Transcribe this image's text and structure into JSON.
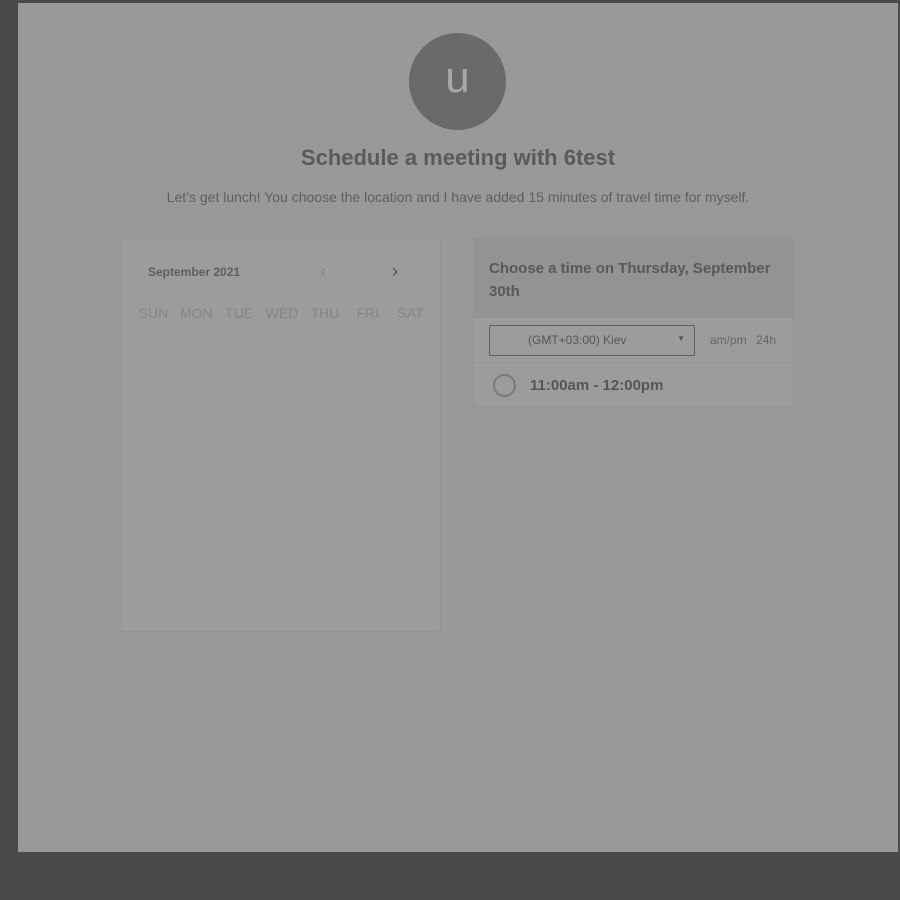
{
  "header": {
    "avatar_letter": "u",
    "title": "Schedule a meeting with 6test",
    "description": "Let’s get lunch! You choose the location and I have added 15 minutes of travel time for myself."
  },
  "calendar": {
    "month": "September 2021",
    "weekdays": [
      "SUN",
      "MON",
      "TUE",
      "WED",
      "THU",
      "FRI",
      "SAT"
    ],
    "prev_icon": "chevron-left-icon",
    "next_icon": "chevron-right-icon"
  },
  "times": {
    "heading": "Choose a time on Thursday, September 30th",
    "timezone": "(GMT+03:00) Kiev",
    "format_options": [
      "am/pm",
      "24h"
    ],
    "slots": [
      "11:00am - 12:00pm"
    ]
  }
}
